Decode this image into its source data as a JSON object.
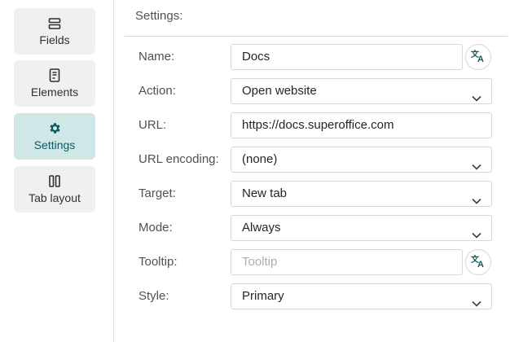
{
  "sidebar": {
    "items": [
      {
        "label": "Fields",
        "icon": "fields-icon"
      },
      {
        "label": "Elements",
        "icon": "elements-icon"
      },
      {
        "label": "Settings",
        "icon": "gear-icon",
        "active": true
      },
      {
        "label": "Tab layout",
        "icon": "tab-layout-icon"
      }
    ]
  },
  "panel": {
    "title": "Settings:"
  },
  "form": {
    "name": {
      "label": "Name:",
      "value": "Docs"
    },
    "action": {
      "label": "Action:",
      "value": "Open website"
    },
    "url": {
      "label": "URL:",
      "value": "https://docs.superoffice.com"
    },
    "url_encoding": {
      "label": "URL encoding:",
      "value": "(none)"
    },
    "target": {
      "label": "Target:",
      "value": "New tab"
    },
    "mode": {
      "label": "Mode:",
      "value": "Always"
    },
    "tooltip": {
      "label": "Tooltip:",
      "value": "",
      "placeholder": "Tooltip"
    },
    "style": {
      "label": "Style:",
      "value": "Primary"
    }
  },
  "colors": {
    "accent": "#0e5b5f",
    "active_bg": "#cfe7e7",
    "nav_bg": "#f0f0f0"
  }
}
